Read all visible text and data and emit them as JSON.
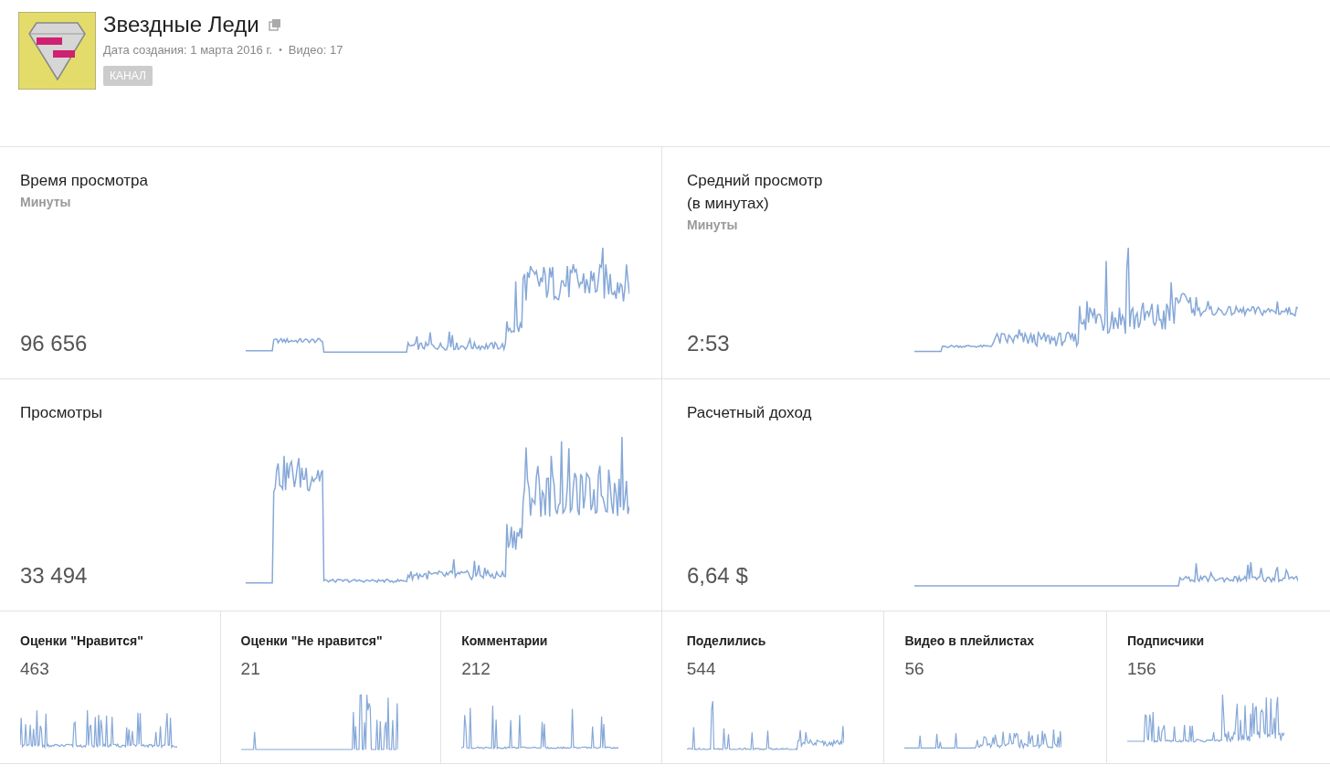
{
  "channel": {
    "name": "Звездные Леди",
    "created": "Дата создания: 1 марта 2016 г.",
    "separator": "•",
    "videos": "Видео: 17",
    "badge": "КАНАЛ"
  },
  "main_metrics": [
    {
      "title": "Время просмотра",
      "unit": "Минуты",
      "value": "96 656"
    },
    {
      "title": "Средний просмотр (в минутах)",
      "unit": "Минуты",
      "value": "2:53"
    },
    {
      "title": "Просмотры",
      "value": "33 494"
    },
    {
      "title": "Расчетный доход",
      "value": "6,64 $"
    }
  ],
  "small_metrics": [
    {
      "title": "Оценки \"Нравится\"",
      "value": "463"
    },
    {
      "title": "Оценки \"Не нравится\"",
      "value": "21"
    },
    {
      "title": "Комментарии",
      "value": "212"
    },
    {
      "title": "Поделились",
      "value": "544"
    },
    {
      "title": "Видео в плейлистах",
      "value": "56"
    },
    {
      "title": "Подписчики",
      "value": "156"
    }
  ]
}
